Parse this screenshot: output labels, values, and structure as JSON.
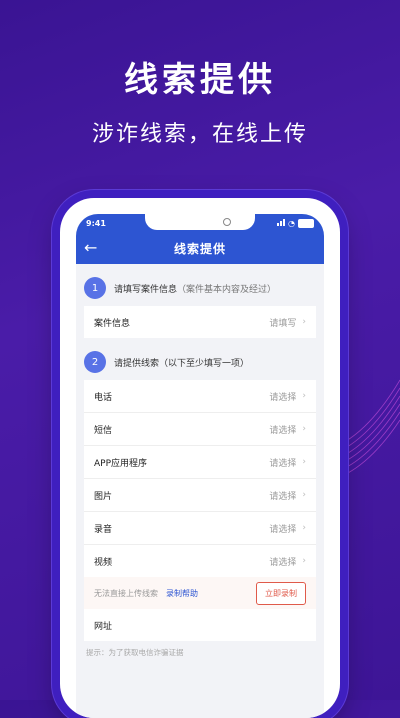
{
  "hero": {
    "title": "线索提供",
    "subtitle": "涉诈线索，在线上传"
  },
  "status": {
    "time": "9:41"
  },
  "nav": {
    "back": "←",
    "title": "线索提供"
  },
  "step1": {
    "num": "1",
    "title": "请填写案件信息",
    "hint": "（案件基本内容及经过）"
  },
  "case": {
    "label": "案件信息",
    "value": "请填写",
    "chev": "›"
  },
  "step2": {
    "num": "2",
    "title": "请提供线索（以下至少填写一项）"
  },
  "clues": [
    {
      "label": "电话",
      "value": "请选择",
      "chev": "›"
    },
    {
      "label": "短信",
      "value": "请选择",
      "chev": "›"
    },
    {
      "label": "APP应用程序",
      "value": "请选择",
      "chev": "›"
    },
    {
      "label": "图片",
      "value": "请选择",
      "chev": "›"
    },
    {
      "label": "录音",
      "value": "请选择",
      "chev": "›"
    },
    {
      "label": "视频",
      "value": "请选择",
      "chev": "›"
    }
  ],
  "record": {
    "note": "无法直接上传线索",
    "help": "录制帮助",
    "button": "立即录制"
  },
  "url": {
    "label": "网址"
  },
  "tip": "提示：为了获取电信诈骗证据",
  "colors": {
    "brand": "#2d55d2",
    "background": "#3a1493",
    "accent": "#e05a4a"
  }
}
